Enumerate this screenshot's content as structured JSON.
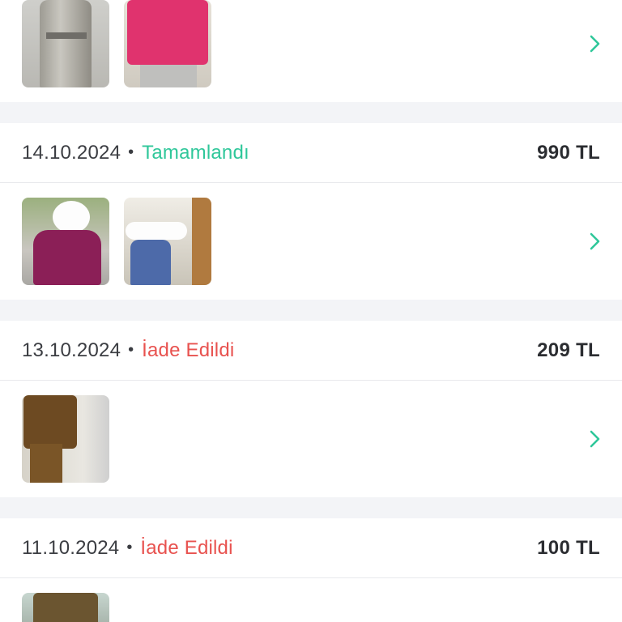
{
  "colors": {
    "completed": "#2fc79a",
    "returned": "#e8524f",
    "chevron": "#2fc79a",
    "separator": "#f3f4f7"
  },
  "orders": [
    {
      "date": "14.10.2024",
      "status": "Tamamlandı",
      "status_type": "completed",
      "price": "990 TL"
    },
    {
      "date": "13.10.2024",
      "status": "İade Edildi",
      "status_type": "returned",
      "price": "209 TL"
    },
    {
      "date": "11.10.2024",
      "status": "İade Edildi",
      "status_type": "returned",
      "price": "100 TL"
    }
  ],
  "icons": {
    "chevron": "chevron-right-icon",
    "separator": "bullet-dot"
  },
  "separator_char": "•"
}
